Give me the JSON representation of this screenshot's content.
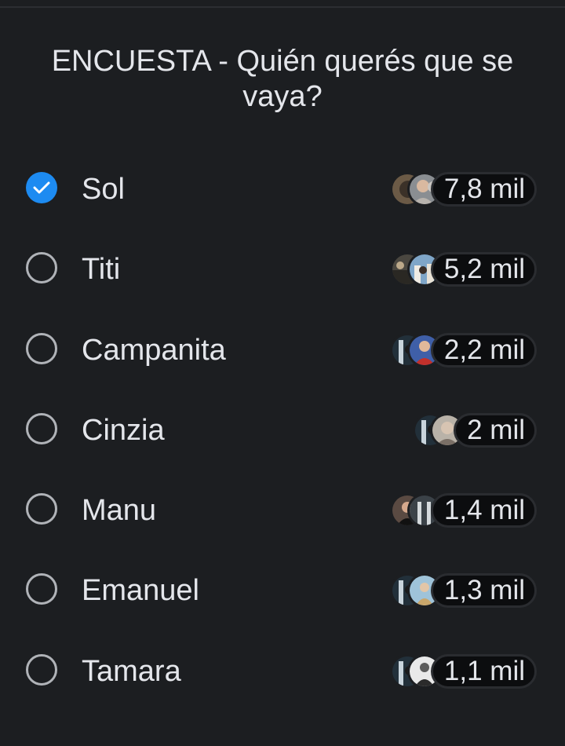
{
  "poll": {
    "title": "ENCUESTA - Quién querés que se vaya?",
    "accent_color": "#1d8bf1",
    "options": [
      {
        "label": "Sol",
        "selected": true,
        "votes": "7,8 mil",
        "voter_avatars": [
          "voter-avatar-icon",
          "voter-avatar-icon"
        ]
      },
      {
        "label": "Titi",
        "selected": false,
        "votes": "5,2 mil",
        "voter_avatars": [
          "voter-avatar-icon",
          "voter-avatar-icon"
        ]
      },
      {
        "label": "Campanita",
        "selected": false,
        "votes": "2,2 mil",
        "voter_avatars": [
          "voter-avatar-icon",
          "voter-avatar-icon"
        ]
      },
      {
        "label": "Cinzia",
        "selected": false,
        "votes": "2 mil",
        "voter_avatars": [
          "voter-avatar-icon",
          "voter-avatar-icon"
        ]
      },
      {
        "label": "Manu",
        "selected": false,
        "votes": "1,4 mil",
        "voter_avatars": [
          "voter-avatar-icon",
          "voter-avatar-icon"
        ]
      },
      {
        "label": "Emanuel",
        "selected": false,
        "votes": "1,3 mil",
        "voter_avatars": [
          "voter-avatar-icon",
          "voter-avatar-icon"
        ]
      },
      {
        "label": "Tamara",
        "selected": false,
        "votes": "1,1 mil",
        "voter_avatars": [
          "voter-avatar-icon",
          "voter-avatar-icon"
        ]
      }
    ]
  }
}
